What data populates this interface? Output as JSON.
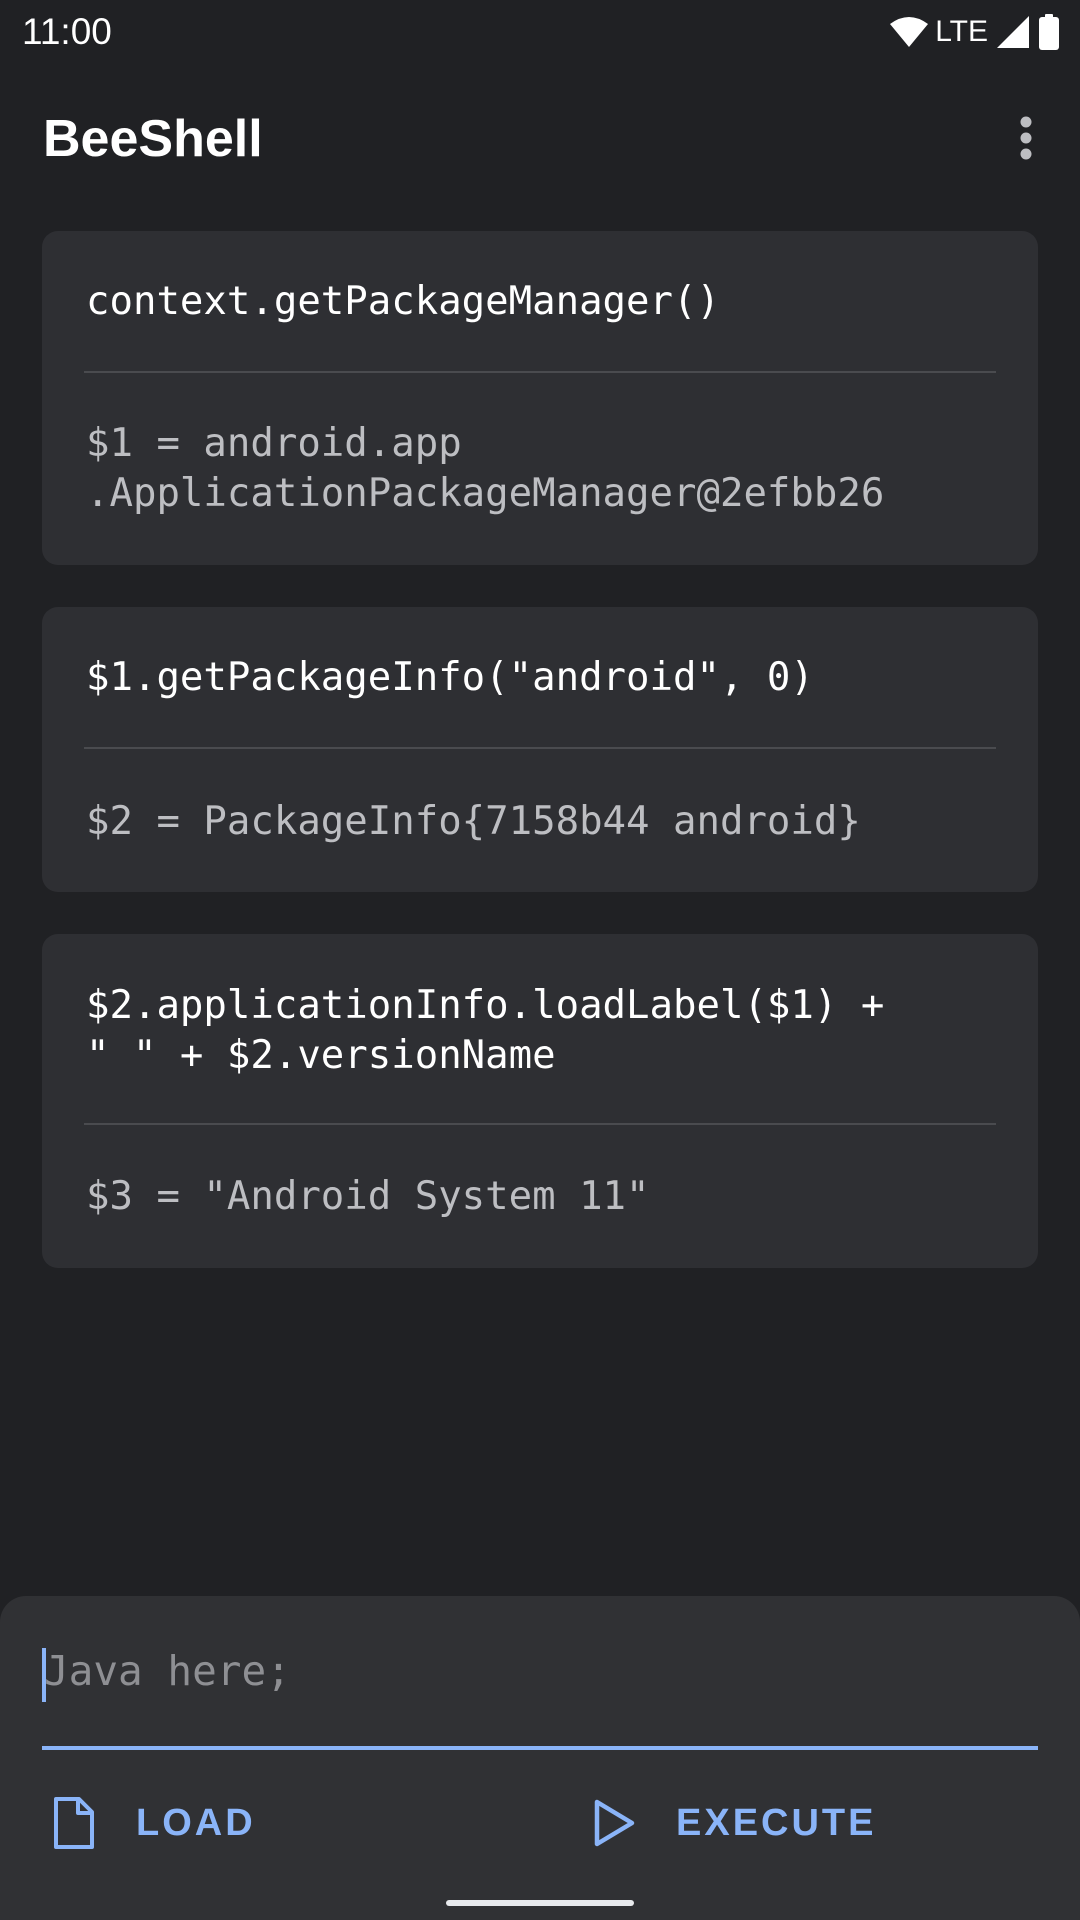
{
  "status_bar": {
    "time": "11:00",
    "network": "LTE",
    "icons": [
      "wifi-icon",
      "signal-icon",
      "battery-icon"
    ]
  },
  "app_bar": {
    "title": "BeeShell",
    "overflow_icon": "more-vert-icon"
  },
  "history": [
    {
      "input": "context.getPackageManager()",
      "output": "$1 = android.app\n.ApplicationPackageManager@2efbb26"
    },
    {
      "input": "$1.getPackageInfo(\"android\", 0)",
      "output": "$2 = PackageInfo{7158b44 android}"
    },
    {
      "input": "$2.applicationInfo.loadLabel($1) +\n\" \" + $2.versionName",
      "output": "$3 = \"Android System 11\""
    }
  ],
  "editor": {
    "placeholder": "Java here;",
    "value": ""
  },
  "actions": {
    "load_label": "LOAD",
    "load_icon": "file-icon",
    "execute_label": "EXECUTE",
    "execute_icon": "play-icon"
  },
  "colors": {
    "background": "#202124",
    "card": "#2e2f33",
    "accent": "#8ab4f8"
  }
}
